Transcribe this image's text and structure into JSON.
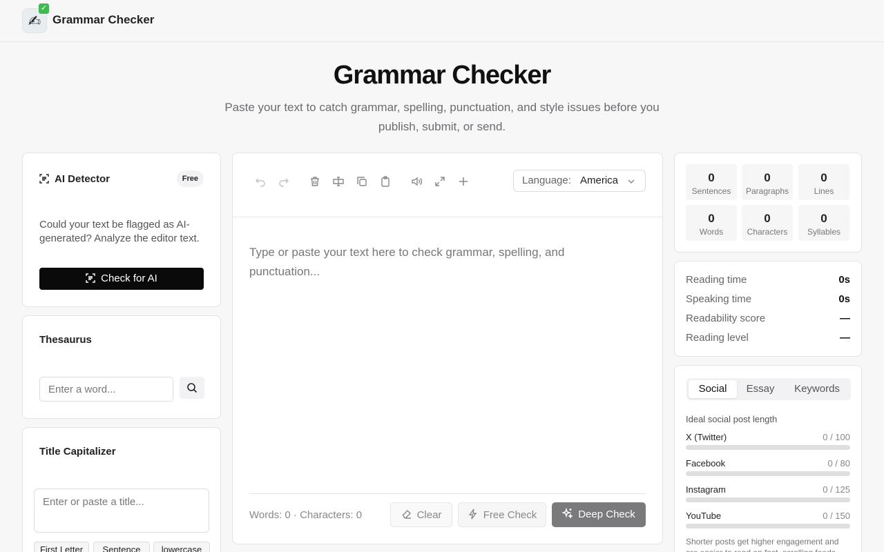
{
  "header": {
    "brand": "Grammar Checker",
    "logo_icon": "writing-hand-icon"
  },
  "hero": {
    "title": "Grammar Checker",
    "subtitle": "Paste your text to catch grammar, spelling, punctuation, and style issues before you publish, submit, or send."
  },
  "ai_detector": {
    "title": "AI Detector",
    "badge": "Free",
    "description": "Could your text be flagged as AI-generated? Analyze the editor text.",
    "button": "Check for AI"
  },
  "thesaurus": {
    "title": "Thesaurus",
    "placeholder": "Enter a word..."
  },
  "title_capitalizer": {
    "title": "Title Capitalizer",
    "placeholder": "Enter or paste a title...",
    "modes": [
      "First Letter",
      "Sentence case",
      "lowercase"
    ]
  },
  "editor": {
    "language_label": "Language:",
    "language_value": "America",
    "placeholder": "Type or paste your text here to check grammar, spelling, and punctuation...",
    "counts": "Words: 0 · Characters: 0",
    "clear_label": "Clear",
    "free_check_label": "Free Check",
    "deep_check_label": "Deep Check"
  },
  "stats": [
    {
      "value": "0",
      "label": "Sentences"
    },
    {
      "value": "0",
      "label": "Paragraphs"
    },
    {
      "value": "0",
      "label": "Lines"
    },
    {
      "value": "0",
      "label": "Words"
    },
    {
      "value": "0",
      "label": "Characters"
    },
    {
      "value": "0",
      "label": "Syllables"
    }
  ],
  "reading": [
    {
      "label": "Reading time",
      "value": "0s"
    },
    {
      "label": "Speaking time",
      "value": "0s"
    },
    {
      "label": "Readability score",
      "value": "—"
    },
    {
      "label": "Reading level",
      "value": "—"
    }
  ],
  "social": {
    "tabs": [
      "Social",
      "Essay",
      "Keywords"
    ],
    "active_tab": "Social",
    "heading": "Ideal social post length",
    "rows": [
      {
        "name": "X (Twitter)",
        "value": "0 / 100",
        "progress": 0
      },
      {
        "name": "Facebook",
        "value": "0 / 80",
        "progress": 0
      },
      {
        "name": "Instagram",
        "value": "0 / 125",
        "progress": 0
      },
      {
        "name": "YouTube",
        "value": "0 / 150",
        "progress": 0
      }
    ],
    "note": "Shorter posts get higher engagement and are easier to read on fast, scrolling feeds."
  }
}
